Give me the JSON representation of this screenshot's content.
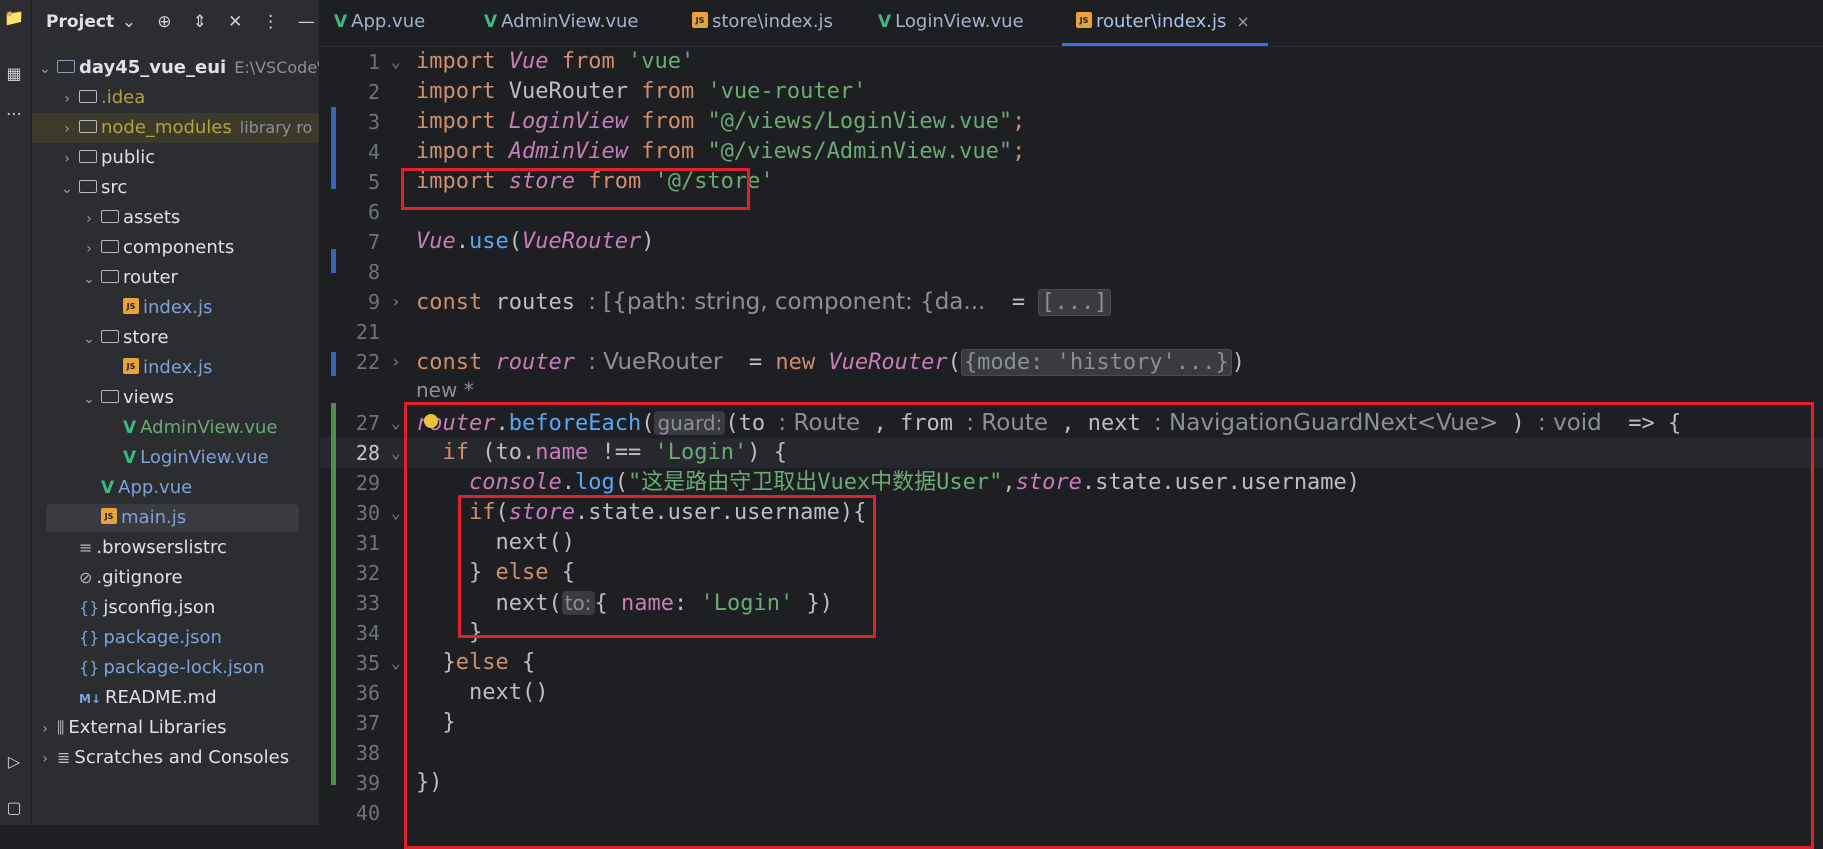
{
  "toolwindow": {
    "title": "Project",
    "icons": [
      "folder-icon",
      "structure-icon",
      "more-icon",
      "run-icon",
      "terminal-icon"
    ]
  },
  "project_header": {
    "title": "Project",
    "tools": [
      "target-icon",
      "expand-icon",
      "collapse-icon",
      "options-icon",
      "hide-icon"
    ]
  },
  "tree": [
    {
      "label": "day45_vue_eui",
      "extra": "E:\\VSCode\\",
      "type": "folder",
      "style": "bold",
      "chevron": "open",
      "indent": 0
    },
    {
      "label": ".idea",
      "type": "folder",
      "style": "olive",
      "chevron": "closed",
      "indent": 1
    },
    {
      "label": "node_modules",
      "extra": "library ro",
      "type": "folder",
      "style": "olive",
      "chevron": "closed",
      "indent": 1,
      "excluded": true
    },
    {
      "label": "public",
      "type": "folder",
      "style": "normal",
      "chevron": "closed",
      "indent": 1
    },
    {
      "label": "src",
      "type": "folder",
      "style": "normal",
      "chevron": "open",
      "indent": 1
    },
    {
      "label": "assets",
      "type": "folder",
      "style": "normal",
      "chevron": "closed",
      "indent": 2
    },
    {
      "label": "components",
      "type": "folder",
      "style": "normal",
      "chevron": "closed",
      "indent": 2
    },
    {
      "label": "router",
      "type": "folder",
      "style": "normal",
      "chevron": "open",
      "indent": 2
    },
    {
      "label": "index.js",
      "type": "js",
      "style": "blue",
      "chevron": "none",
      "indent": 3
    },
    {
      "label": "store",
      "type": "folder",
      "style": "normal",
      "chevron": "open",
      "indent": 2
    },
    {
      "label": "index.js",
      "type": "js",
      "style": "blue",
      "chevron": "none",
      "indent": 3
    },
    {
      "label": "views",
      "type": "folder",
      "style": "normal",
      "chevron": "open",
      "indent": 2
    },
    {
      "label": "AdminView.vue",
      "type": "vue",
      "style": "green",
      "chevron": "none",
      "indent": 3
    },
    {
      "label": "LoginView.vue",
      "type": "vue",
      "style": "blue",
      "chevron": "none",
      "indent": 3
    },
    {
      "label": "App.vue",
      "type": "vue",
      "style": "blue",
      "chevron": "none",
      "indent": 2
    },
    {
      "label": "main.js",
      "type": "js",
      "style": "blue",
      "chevron": "none",
      "indent": 2,
      "selected": true
    },
    {
      "label": ".browserslistrc",
      "type": "text",
      "style": "normal",
      "chevron": "none",
      "indent": 1
    },
    {
      "label": ".gitignore",
      "type": "ignore",
      "style": "normal",
      "chevron": "none",
      "indent": 1
    },
    {
      "label": "jsconfig.json",
      "type": "json",
      "style": "normal",
      "chevron": "none",
      "indent": 1
    },
    {
      "label": "package.json",
      "type": "json",
      "style": "blue",
      "chevron": "none",
      "indent": 1
    },
    {
      "label": "package-lock.json",
      "type": "json",
      "style": "blue",
      "chevron": "none",
      "indent": 1
    },
    {
      "label": "README.md",
      "type": "md",
      "style": "normal",
      "chevron": "none",
      "indent": 1
    },
    {
      "label": "External Libraries",
      "type": "lib",
      "style": "normal",
      "chevron": "closed",
      "indent": 0
    },
    {
      "label": "Scratches and Consoles",
      "type": "scratch",
      "style": "normal",
      "chevron": "closed",
      "indent": 0
    }
  ],
  "tabs": [
    {
      "label": "App.vue",
      "type": "vue",
      "active": false
    },
    {
      "label": "AdminView.vue",
      "type": "vue",
      "active": false
    },
    {
      "label": "store\\index.js",
      "type": "js",
      "active": false
    },
    {
      "label": "LoginView.vue",
      "type": "vue",
      "active": false
    },
    {
      "label": "router\\index.js",
      "type": "js",
      "active": true,
      "close": "×"
    }
  ],
  "editor": {
    "current_line": "28",
    "note": "new *",
    "lines": [
      {
        "n": "1",
        "fold": "open"
      },
      {
        "n": "2"
      },
      {
        "n": "3"
      },
      {
        "n": "4"
      },
      {
        "n": "5"
      },
      {
        "n": "6"
      },
      {
        "n": "7"
      },
      {
        "n": "8"
      },
      {
        "n": "9",
        "fold": "closed"
      },
      {
        "n": "21"
      },
      {
        "n": "22",
        "fold": "closed"
      },
      {
        "n": "27",
        "fold": "open"
      },
      {
        "n": "28",
        "fold": "open"
      },
      {
        "n": "29"
      },
      {
        "n": "30",
        "fold": "open"
      },
      {
        "n": "31"
      },
      {
        "n": "32"
      },
      {
        "n": "33"
      },
      {
        "n": "34"
      },
      {
        "n": "35",
        "fold": "open"
      },
      {
        "n": "36"
      },
      {
        "n": "37"
      },
      {
        "n": "38"
      },
      {
        "n": "39"
      },
      {
        "n": "40"
      }
    ],
    "tokens": {
      "l1": [
        "import",
        "Vue",
        "from",
        "'vue'"
      ],
      "l2": [
        "import",
        "VueRouter",
        "from",
        "'vue-router'"
      ],
      "l3": [
        "import",
        "LoginView",
        "from",
        "\"@/views/LoginView.vue\"",
        ";"
      ],
      "l4": [
        "import",
        "AdminView",
        "from",
        "\"@/views/AdminView.vue\"",
        ";"
      ],
      "l5": [
        "import",
        "store",
        "from",
        "'@/store'"
      ],
      "l7": [
        "Vue",
        ".",
        "use",
        "(",
        "VueRouter",
        ")"
      ],
      "l9": [
        "const",
        "routes",
        ": [{path: string, component: {da...",
        "=",
        "[...]"
      ],
      "l22": [
        "const",
        "router",
        ": VueRouter",
        "=",
        "new",
        "VueRouter",
        "(",
        "{mode: 'history'...}",
        ")"
      ],
      "l27": [
        "router",
        ".",
        "beforeEach",
        "(",
        "guard:",
        "(to",
        ": Route",
        ",",
        "from",
        ": Route",
        ",",
        "next",
        ": NavigationGuardNext<Vue>",
        ")",
        ": void",
        "=> {"
      ],
      "l28": [
        "if",
        "(to.",
        "name",
        "!==",
        "'Login'",
        ")",
        "{"
      ],
      "l29": [
        "console",
        ".",
        "log",
        "(",
        "\"这是路由守卫取出Vuex中数据User\"",
        ",",
        "store",
        ".state.user.username)"
      ],
      "l30": [
        "if",
        "(",
        "store",
        ".state.user.username){"
      ],
      "l31": [
        "next()"
      ],
      "l32": [
        "}",
        "else",
        "{"
      ],
      "l33": [
        "next(",
        "to:",
        "{",
        "name",
        ":",
        "'Login'",
        "})"
      ],
      "l34": [
        "}"
      ],
      "l35": [
        "}",
        "else",
        "{"
      ],
      "l36": [
        "next()"
      ],
      "l37": [
        "}"
      ],
      "l39": [
        "})"
      ]
    }
  },
  "colors": {
    "highlight_box": "#e0202a",
    "keyword": "#cf8e6d",
    "string": "#6aab73",
    "function": "#56a8f5",
    "italic_symbol": "#c77dbb",
    "accent": "#3574f0"
  }
}
